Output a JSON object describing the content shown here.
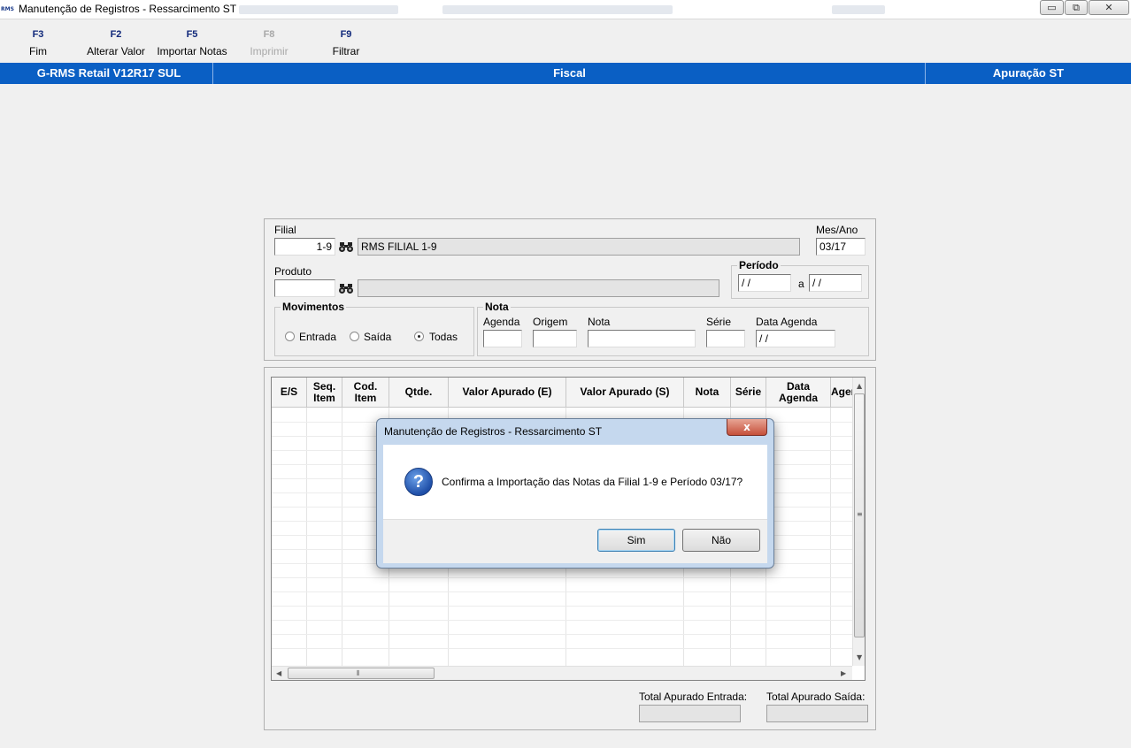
{
  "window": {
    "title": "Manutenção de Registros - Ressarcimento ST",
    "icon_text": "RMS",
    "minimize": "▭",
    "restore": "⧉",
    "close": "✕"
  },
  "toolbar": {
    "keys": [
      {
        "key": "F3",
        "label": "Fim"
      },
      {
        "key": "F2",
        "label": "Alterar Valor"
      },
      {
        "key": "F5",
        "label": "Importar Notas"
      },
      {
        "key": "F8",
        "label": "Imprimir"
      },
      {
        "key": "F9",
        "label": "Filtrar"
      }
    ]
  },
  "header": {
    "system": "G-RMS Retail V12R17 SUL",
    "module": "Fiscal",
    "function": "Apuração ST"
  },
  "form": {
    "filial_label": "Filial",
    "filial_value": "1-9",
    "filial_name": "RMS FILIAL 1-9",
    "mesano_label": "Mes/Ano",
    "mesano_value": "03/17",
    "produto_label": "Produto",
    "produto_value": "",
    "produto_desc": "",
    "periodo_label": "Período",
    "periodo_from": " / /",
    "periodo_sep": "a",
    "periodo_to": " / /",
    "movimentos_label": "Movimentos",
    "mov_options": [
      "Entrada",
      "Saída",
      "Todas"
    ],
    "mov_selected": "Todas",
    "nota_group_label": "Nota",
    "agenda_label": "Agenda",
    "origem_label": "Origem",
    "nota_label": "Nota",
    "serie_label": "Série",
    "data_agenda_label": "Data Agenda",
    "data_agenda_value": " / /"
  },
  "grid": {
    "columns": [
      "E/S",
      "Seq. Item",
      "Cod. Item",
      "Qtde.",
      "Valor Apurado (E)",
      "Valor Apurado (S)",
      "Nota",
      "Série",
      "Data Agenda",
      "Agen"
    ],
    "rows": []
  },
  "totals": {
    "entrada_label": "Total Apurado Entrada:",
    "entrada_value": "",
    "saida_label": "Total Apurado Saída:",
    "saida_value": ""
  },
  "dialog": {
    "title": "Manutenção de Registros - Ressarcimento ST",
    "close": "x",
    "icon": "?",
    "message": "Confirma a Importação das Notas da Filial 1-9 e Período 03/17?",
    "yes": "Sim",
    "no": "Não"
  },
  "colors": {
    "header_blue": "#0a5fc4",
    "fkey_blue": "#10287a"
  }
}
